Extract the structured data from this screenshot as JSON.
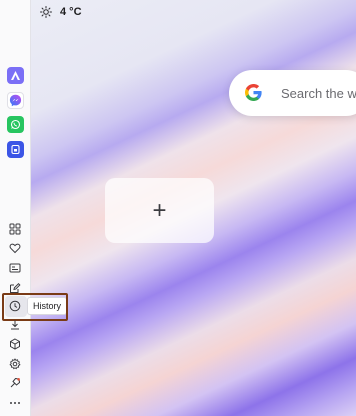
{
  "weather": {
    "icon": "sun-icon",
    "temperature": "4 °C"
  },
  "sidebar": {
    "apps": [
      {
        "name": "copilot-designer",
        "icon": "designer-icon",
        "color": "#6d6cf5"
      },
      {
        "name": "messenger",
        "icon": "messenger-icon",
        "color": "#a25cf0"
      },
      {
        "name": "whatsapp",
        "icon": "whatsapp-icon",
        "color": "#25d366"
      },
      {
        "name": "app-shortcut",
        "icon": "app-shortcut-icon",
        "color": "#3a57e8"
      }
    ],
    "tools": [
      {
        "name": "apps-grid",
        "icon": "grid-icon"
      },
      {
        "name": "favorites",
        "icon": "heart-icon"
      },
      {
        "name": "collections",
        "icon": "collections-icon"
      },
      {
        "name": "edit",
        "icon": "edit-icon"
      },
      {
        "name": "history",
        "icon": "clock-icon"
      },
      {
        "name": "downloads",
        "icon": "download-icon"
      },
      {
        "name": "extensions",
        "icon": "cube-icon"
      },
      {
        "name": "settings",
        "icon": "gear-icon"
      },
      {
        "name": "performance",
        "icon": "performance-icon"
      },
      {
        "name": "more",
        "icon": "more-icon"
      }
    ],
    "tooltip": "History"
  },
  "search": {
    "placeholder": "Search the we",
    "logo": "google-icon"
  },
  "add_tile": {
    "label": "+"
  }
}
